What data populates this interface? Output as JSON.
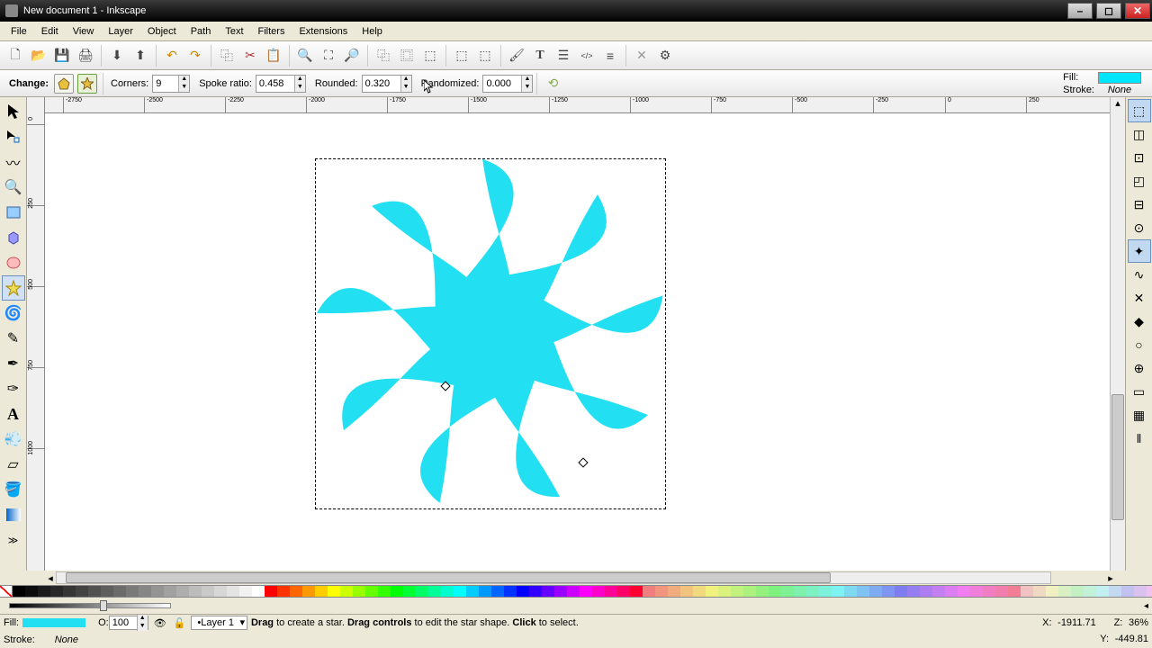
{
  "app": {
    "title": "New document 1 - Inkscape"
  },
  "menu": [
    "File",
    "Edit",
    "View",
    "Layer",
    "Object",
    "Path",
    "Text",
    "Filters",
    "Extensions",
    "Help"
  ],
  "options": {
    "change_label": "Change:",
    "corners_label": "Corners:",
    "corners": "9",
    "spoke_label": "Spoke ratio:",
    "spoke": "0.458",
    "rounded_label": "Rounded:",
    "rounded": "0.320",
    "random_label": "Randomized:",
    "random": "0.000"
  },
  "fillstroke": {
    "fill_label": "Fill:",
    "stroke_label": "Stroke:",
    "stroke_value": "None"
  },
  "ruler_h": [
    "-2750",
    "-2500",
    "-2250",
    "-2000",
    "-1750",
    "-1500",
    "-1250",
    "-1000",
    "-750",
    "-500",
    "-250",
    "0",
    "250"
  ],
  "ruler_v": [
    "0",
    "250",
    "500",
    "750",
    "1000"
  ],
  "status": {
    "fill_label": "Fill:",
    "stroke_label": "Stroke:",
    "stroke_value": "None",
    "opacity_label": "O:",
    "opacity": "100",
    "layer": "Layer 1",
    "hint_pre": "Drag",
    "hint_mid1": " to create a star. ",
    "hint_bold2": "Drag controls",
    "hint_mid2": " to edit the star shape. ",
    "hint_bold3": "Click",
    "hint_mid3": " to select.",
    "x_label": "X:",
    "x": "-1911.71",
    "y_label": "Y:",
    "y": "-449.81",
    "z_label": "Z:",
    "z": "36%"
  },
  "colors": {
    "shape": "#22DFF1",
    "fill_swatch": "#00E6FF"
  }
}
